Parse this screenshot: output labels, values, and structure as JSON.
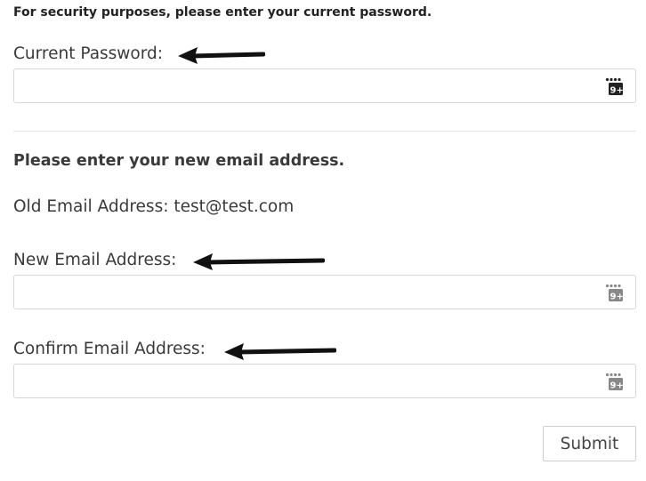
{
  "notice": "For security purposes, please enter your current password.",
  "current_password": {
    "label": "Current Password:",
    "value": "",
    "placeholder": "",
    "icon": "keypad-icon"
  },
  "heading": "Please enter your new email address.",
  "old_email": {
    "text": "Old Email Address: test@test.com"
  },
  "new_email": {
    "label": "New Email Address:",
    "value": "",
    "placeholder": "",
    "icon": "keypad-icon"
  },
  "confirm_email": {
    "label": "Confirm Email Address:",
    "value": "",
    "placeholder": "",
    "icon": "keypad-icon"
  },
  "submit_label": "Submit",
  "annotation_arrow_color": "#111111"
}
